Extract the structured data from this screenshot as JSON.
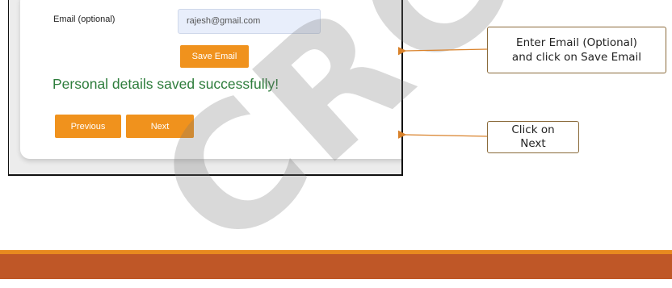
{
  "form": {
    "email_label": "Email (optional)",
    "email_value": "rajesh@gmail.com",
    "save_email_label": "Save Email",
    "success_message": "Personal details saved successfully!",
    "previous_label": "Previous",
    "next_label": "Next"
  },
  "callouts": {
    "email_line1": "Enter Email (Optional)",
    "email_line2": "and click on Save Email",
    "next_line1": "Click on",
    "next_line2": "Next"
  },
  "watermark": "CRC",
  "colors": {
    "button": "#f0921d",
    "success_text": "#2e7d3c",
    "footer_bar": "#bf5727",
    "footer_line": "#e8891f",
    "arrow": "#d9822b"
  }
}
